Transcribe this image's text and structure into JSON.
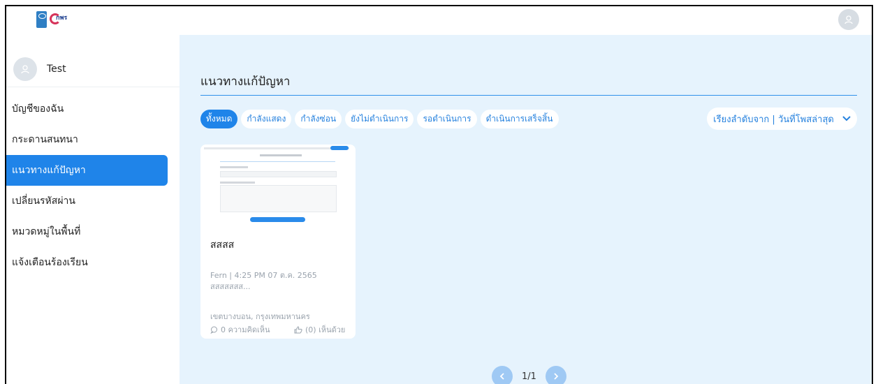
{
  "header": {
    "logo_text": "กพร",
    "user_icon": "user-icon"
  },
  "sidebar": {
    "user": {
      "name": "Test",
      "avatar_icon": "user-icon"
    },
    "items": [
      {
        "label": "บัญชีของฉัน",
        "active": false
      },
      {
        "label": "กระดานสนทนา",
        "active": false
      },
      {
        "label": "แนวทางแก้ปัญหา",
        "active": true
      },
      {
        "label": "เปลี่ยนรหัสผ่าน",
        "active": false
      },
      {
        "label": "หมวดหมู่ในพื้นที่",
        "active": false
      },
      {
        "label": "แจ้งเตือนร้องเรียน",
        "active": false
      }
    ]
  },
  "main": {
    "title": "แนวทางแก้ปัญหา",
    "filters": [
      "ทั้งหมด",
      "กำลังแสดง",
      "กำลังซ่อน",
      "ยังไม่ดำเนินการ",
      "รอดำเนินการ",
      "ดำเนินการเสร็จสิ้น"
    ],
    "active_filter": "ทั้งหมด",
    "sort_label": "เรียงลำดับจาก | วันที่โพสล่าสุด",
    "sort_icon": "chevron-down-icon",
    "cards": [
      {
        "title": "สสสส",
        "author": "Fern",
        "date": "4:25 PM 07 ต.ค. 2565",
        "excerpt": "สสสสสสส...",
        "location": "เขตบางบอน, กรุงเทพมหานคร",
        "comments": "0 ความคิดเห็น",
        "agree": "(0) เห็นด้วย"
      }
    ],
    "pagination": {
      "text": "1/1",
      "prev_icon": "chevron-left-icon",
      "next_icon": "chevron-right-icon"
    }
  },
  "colors": {
    "accent": "#1f84e9",
    "main_bg": "#e6f3fd",
    "muted_text": "#9aa3ad"
  }
}
